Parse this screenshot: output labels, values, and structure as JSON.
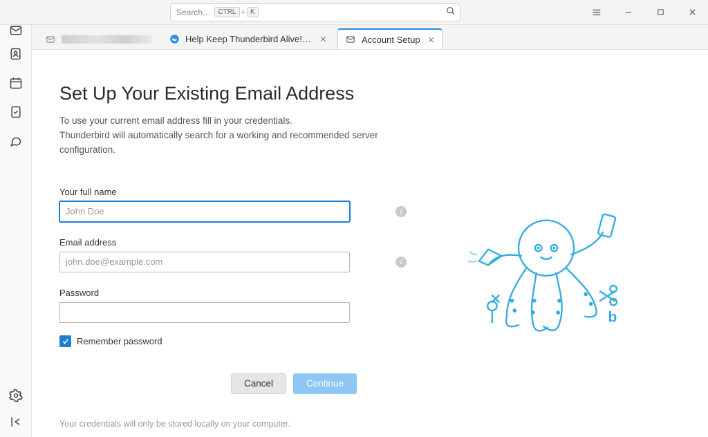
{
  "titlebar": {
    "search_placeholder": "Search…",
    "shortcut_key1": "CTRL",
    "shortcut_plus": "+",
    "shortcut_key2": "K"
  },
  "tabs": {
    "help_tab_label": "Help Keep Thunderbird Alive! — Th",
    "setup_tab_label": "Account Setup"
  },
  "setup": {
    "title": "Set Up Your Existing Email Address",
    "desc_line1": "To use your current email address fill in your credentials.",
    "desc_line2": "Thunderbird will automatically search for a working and recommended server configuration.",
    "name_label": "Your full name",
    "name_placeholder": "John Doe",
    "email_label": "Email address",
    "email_placeholder": "john.doe@example.com",
    "password_label": "Password",
    "remember_label": "Remember password",
    "cancel_label": "Cancel",
    "continue_label": "Continue",
    "footnote": "Your credentials will only be stored locally on your computer."
  }
}
